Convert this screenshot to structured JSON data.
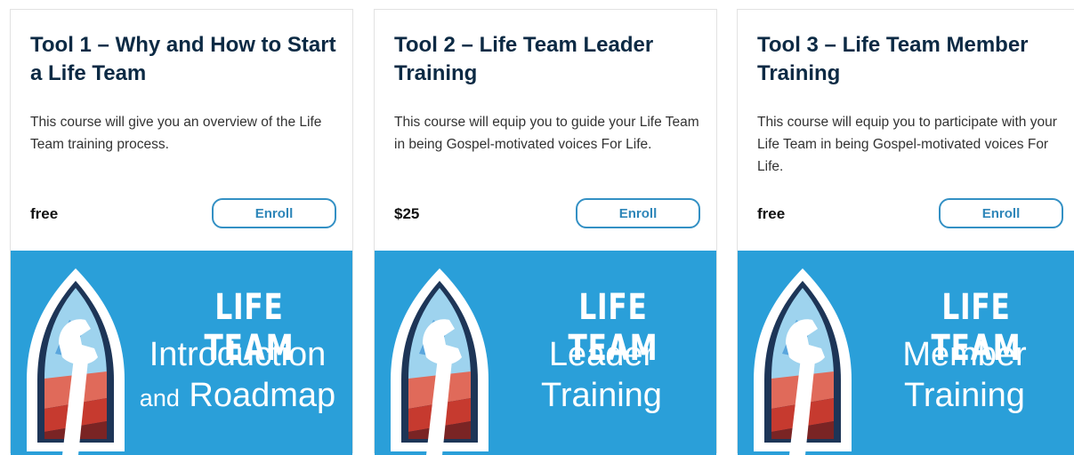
{
  "courses": [
    {
      "title": "Tool 1 – Why and How to Start a Life Team",
      "description": "This course will give you an overview of the Life Team training process.",
      "price": "free",
      "enroll_label": "Enroll",
      "banner": {
        "heading": "LIFE TEAM",
        "line1": "Introduction",
        "line2_small": "and",
        "line2": "Roadmap"
      }
    },
    {
      "title": "Tool 2 – Life Team Leader Training",
      "description": "This course will equip you to guide your Life Team in being Gospel-motivated voices For Life.",
      "price": "$25",
      "enroll_label": "Enroll",
      "banner": {
        "heading": "LIFE TEAM",
        "line1": "Leader",
        "line2_small": "",
        "line2": "Training"
      }
    },
    {
      "title": "Tool 3 – Life Team Member Training",
      "description": "This course will equip you to participate with your Life Team in being Gospel-motivated voices For Life.",
      "price": "free",
      "enroll_label": "Enroll",
      "banner": {
        "heading": "LIFE TEAM",
        "line1": "Member",
        "line2_small": "",
        "line2": "Training"
      }
    }
  ],
  "colors": {
    "title": "#0c2a44",
    "accent": "#3390c4",
    "banner_bg": "#2a9fd9"
  }
}
